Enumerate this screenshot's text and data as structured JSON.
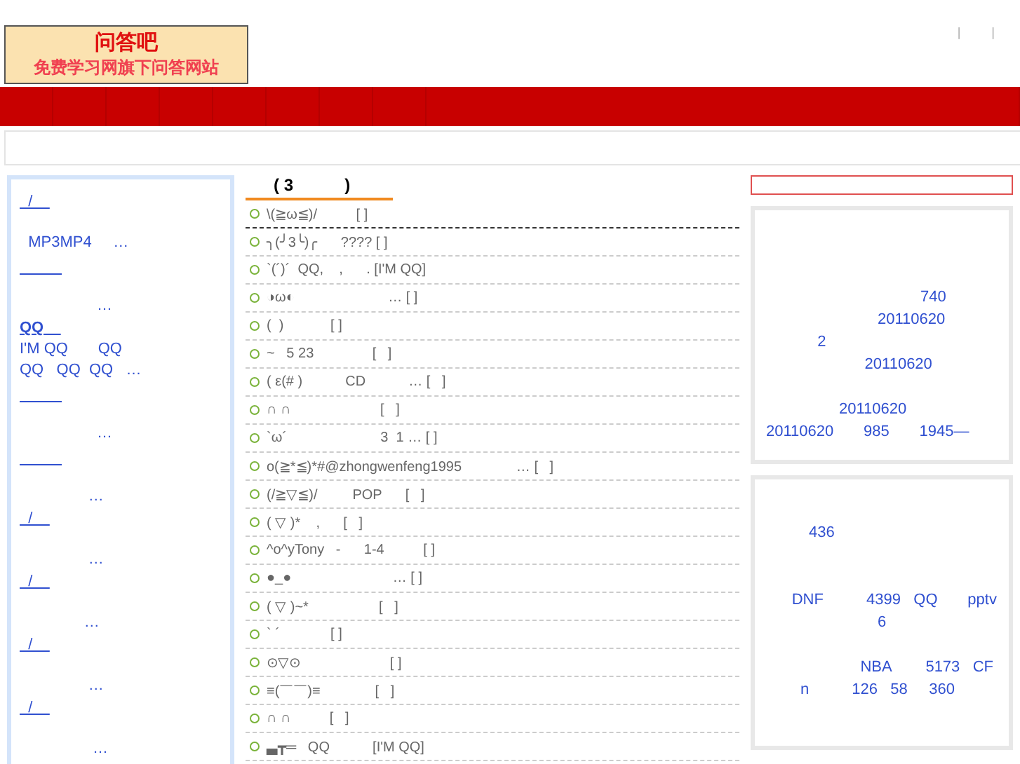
{
  "header": {
    "logo": {
      "title": "问答吧",
      "subtitle": "免费学习网旗下问答网站"
    },
    "top_links": [
      "|",
      "|"
    ]
  },
  "sidebar": {
    "rows": [
      {
        "kind": "link",
        "text": "  /    "
      },
      {
        "kind": "spacer"
      },
      {
        "kind": "text",
        "text": "  MP3MP4     …"
      },
      {
        "kind": "blank-link"
      },
      {
        "kind": "spacer"
      },
      {
        "kind": "text",
        "text": "                  …"
      },
      {
        "kind": "link",
        "text": "QQ    "
      },
      {
        "kind": "text",
        "text": "I'M QQ       QQ"
      },
      {
        "kind": "text",
        "text": "QQ   QQ  QQ   …"
      },
      {
        "kind": "blank-link"
      },
      {
        "kind": "spacer"
      },
      {
        "kind": "text",
        "text": "                  …"
      },
      {
        "kind": "blank-link"
      },
      {
        "kind": "spacer"
      },
      {
        "kind": "text",
        "text": "                …"
      },
      {
        "kind": "link",
        "text": "  /    "
      },
      {
        "kind": "spacer"
      },
      {
        "kind": "text",
        "text": "                …"
      },
      {
        "kind": "link",
        "text": "  /    "
      },
      {
        "kind": "spacer"
      },
      {
        "kind": "text",
        "text": "               …"
      },
      {
        "kind": "link",
        "text": "  /    "
      },
      {
        "kind": "spacer"
      },
      {
        "kind": "text",
        "text": "                …"
      },
      {
        "kind": "link",
        "text": "  /    "
      },
      {
        "kind": "spacer"
      },
      {
        "kind": "text",
        "text": "                 …"
      }
    ]
  },
  "posts": {
    "heading": "      ( 3           )",
    "items": [
      "\\(≧ω≦)/          [ ]",
      "╮(╯3╰)╭      ???? [ ]",
      "`(´)´  QQ,    ,      . [I'M QQ]",
      "◑ω◐                        … [ ]",
      "(  )            [ ]",
      "~   5 23               [   ]",
      "( ε(# )           CD           … [   ]",
      "∩ ∩                       [   ]",
      "`ω´                        3  1 … [ ]",
      "o(≧*≦)*#@zhongwenfeng1995              … [   ]",
      "(/≧▽≦)/         POP      [   ]",
      "( ▽ )*    ,      [   ]",
      "^o^yTony   -      1-4          [ ]",
      "●_●                          … [ ]",
      "( ▽ )~*                  [   ]",
      "` ´             [ ]",
      "⊙▽⊙                       [ ]",
      "≡(￣￣)≡              [   ]",
      "∩ ∩          [   ]",
      "▃┳═   QQ           [I'M QQ]"
    ]
  },
  "right": {
    "boxes": [
      {
        "lines": [
          {
            "kind": "blank"
          },
          {
            "kind": "blank"
          },
          {
            "kind": "blank"
          },
          {
            "kind": "text",
            "text": "                                    740"
          },
          {
            "kind": "text",
            "text": "                          20110620"
          },
          {
            "kind": "text",
            "text": "            2"
          },
          {
            "kind": "text",
            "text": "                       20110620"
          },
          {
            "kind": "blank"
          },
          {
            "kind": "text",
            "text": "                 20110620"
          },
          {
            "kind": "text",
            "text": "20110620       985       1945—"
          }
        ]
      },
      {
        "lines": [
          {
            "kind": "blank"
          },
          {
            "kind": "text",
            "text": "          436"
          },
          {
            "kind": "blank"
          },
          {
            "kind": "blank"
          },
          {
            "kind": "text",
            "text": "      DNF          4399   QQ       pptv"
          },
          {
            "kind": "text",
            "text": "                          6"
          },
          {
            "kind": "blank"
          },
          {
            "kind": "text",
            "text": "                      NBA        5173   CF"
          },
          {
            "kind": "text",
            "text": "        n          126   58     360"
          }
        ]
      }
    ]
  }
}
